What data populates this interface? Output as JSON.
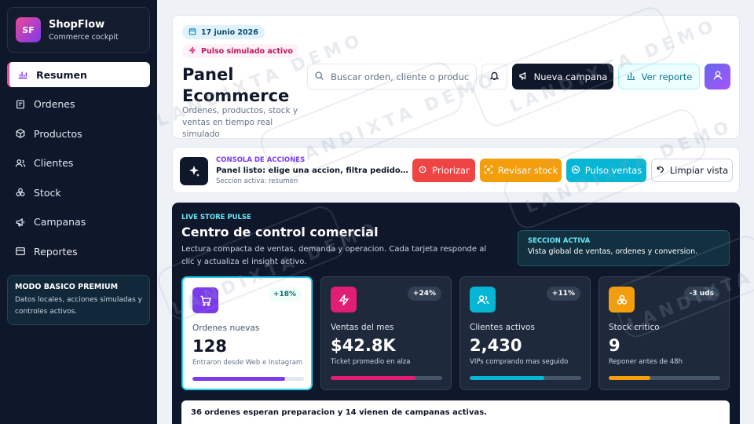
{
  "brand": {
    "initials": "SF",
    "name": "ShopFlow",
    "subtitle": "Commerce cockpit"
  },
  "sidebar": {
    "items": [
      {
        "label": "Resumen",
        "icon": "chart-icon",
        "active": true
      },
      {
        "label": "Ordenes",
        "icon": "orders-icon"
      },
      {
        "label": "Productos",
        "icon": "box-icon"
      },
      {
        "label": "Clientes",
        "icon": "users-icon"
      },
      {
        "label": "Stock",
        "icon": "stack-icon"
      },
      {
        "label": "Campanas",
        "icon": "megaphone-icon"
      },
      {
        "label": "Reportes",
        "icon": "report-icon"
      }
    ],
    "premium": {
      "title": "MODO BASICO PREMIUM",
      "text": "Datos locales, acciones simuladas y controles activos."
    }
  },
  "header": {
    "date": "17 junio 2026",
    "pulse": "Pulso simulado activo",
    "title": "Panel Ecommerce",
    "subtitle": "Ordenes, productos, stock y ventas en tiempo real simulado",
    "search_placeholder": "Buscar orden, cliente o producto",
    "new_campaign": "Nueva campana",
    "view_report": "Ver reporte"
  },
  "console": {
    "label": "CONSOLA DE ACCIONES",
    "title": "Panel listo: elige una accion, filtra pedidos o revisa stock.",
    "section": "Seccion activa: resumen",
    "buttons": {
      "prioritize": "Priorizar",
      "stock": "Revisar stock",
      "pulse": "Pulso ventas",
      "clear": "Limpiar vista"
    }
  },
  "pulse": {
    "label": "LIVE STORE PULSE",
    "title": "Centro de control comercial",
    "subtitle": "Lectura compacta de ventas, demanda y operacion. Cada tarjeta responde al clic y actualiza el insight activo.",
    "active": {
      "title": "SECCION ACTIVA",
      "text": "Vista global de ventas, ordenes y conversion."
    },
    "kpis": [
      {
        "name": "Ordenes nuevas",
        "value": "128",
        "badge": "+18%",
        "note": "Entraron desde Web e Instagram",
        "progress": 0.83,
        "color": "#7c3aed",
        "icon": "cart-icon"
      },
      {
        "name": "Ventas del mes",
        "value": "$42.8K",
        "badge": "+24%",
        "note": "Ticket promedio en alza",
        "progress": 0.76,
        "color": "#e11d74",
        "icon": "bolt-icon"
      },
      {
        "name": "Clientes activos",
        "value": "2,430",
        "badge": "+11%",
        "note": "VIPs comprando mas seguido",
        "progress": 0.67,
        "color": "#06b6d4",
        "icon": "users-icon"
      },
      {
        "name": "Stock critico",
        "value": "9",
        "badge": "-3 uds",
        "note": "Reponer antes de 48h",
        "progress": 0.37,
        "color": "#f59e0b",
        "icon": "stack-icon"
      }
    ],
    "footer": "36 ordenes esperan preparacion y 14 vienen de campanas activas."
  },
  "watermark": "LANDIXTA DEMO",
  "colors": {
    "accent": "#7c3aed",
    "pink": "#ec4899",
    "cyan": "#06b6d4",
    "orange": "#f59e0b",
    "red": "#ef4444",
    "dark": "#0f172a"
  }
}
